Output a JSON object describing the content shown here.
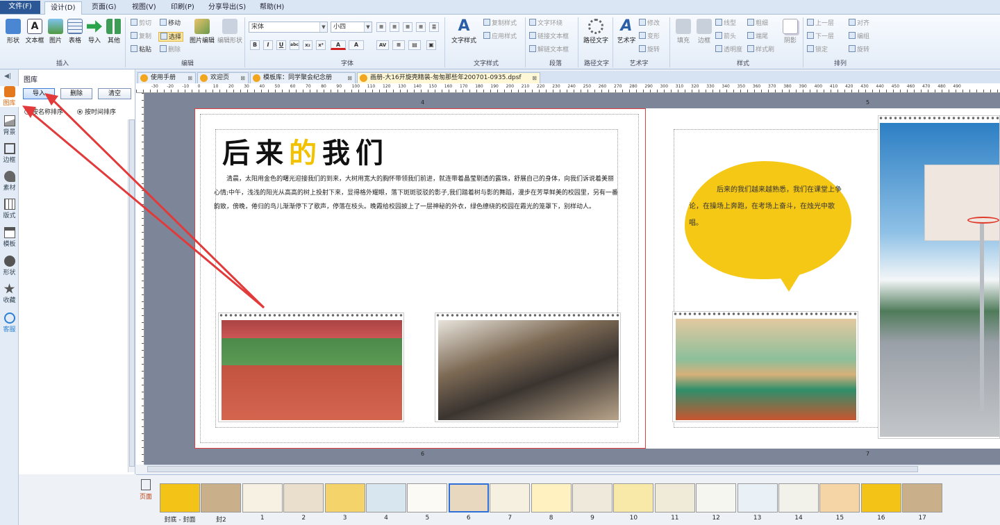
{
  "menu": [
    "文件(F)",
    "设计(D)",
    "页面(G)",
    "视图(V)",
    "印刷(P)",
    "分享导出(S)",
    "帮助(H)"
  ],
  "ribbon": {
    "insert": {
      "buttons": [
        "形状",
        "文本框",
        "图片",
        "表格",
        "导入",
        "其他"
      ],
      "label": "插入"
    },
    "edit": {
      "items": [
        "剪切",
        "复制",
        "粘贴",
        "移动",
        "选择",
        "删除"
      ],
      "big": "图片编辑",
      "big2": "编辑形状",
      "label": "编辑"
    },
    "font": {
      "face": "宋体",
      "size": "小四",
      "label": "字体"
    },
    "textstyle": {
      "big": "文字样式",
      "items": [
        "复制样式",
        "应用样式"
      ],
      "label": "文字样式"
    },
    "paragraph": {
      "items": [
        "文字环绕",
        "链接文本框",
        "解链文本框"
      ],
      "label": "段落"
    },
    "pathtext": {
      "big": "路径文字",
      "label": "路径文字"
    },
    "arttext": {
      "big": "艺术字",
      "items": [
        "修改",
        "变形",
        "旋转"
      ],
      "label": "艺术字"
    },
    "style": {
      "items": [
        "填充",
        "边框",
        "线型",
        "粗细",
        "箭头",
        "端尾",
        "透明度",
        "样式刷",
        "阴影"
      ],
      "label": "样式"
    },
    "arrange": {
      "items": [
        "上一层",
        "下一层",
        "锁定",
        "对齐",
        "编组",
        "旋转"
      ],
      "label": "排列"
    }
  },
  "leftstrip": [
    "图库",
    "背景",
    "边框",
    "素材",
    "版式",
    "模板",
    "形状",
    "收藏",
    "客服"
  ],
  "panel": {
    "title": "图库",
    "buttons": [
      "导入",
      "删除",
      "清空"
    ],
    "sort_name": "按名称排序",
    "sort_time": "按时间排序"
  },
  "tabs": [
    "使用手册",
    "欢迎页",
    "模板库：同学聚会纪念册",
    "画册-大16开旋壳精装-匆匆那些年200701-0935.dpsf"
  ],
  "ruler_ticks": [
    "-30",
    "-20",
    "-10",
    "0",
    "10",
    "20",
    "30",
    "40",
    "50",
    "60",
    "70",
    "80",
    "90",
    "100",
    "110",
    "120",
    "130",
    "140",
    "150",
    "160",
    "170",
    "180",
    "190",
    "200",
    "210",
    "220",
    "230",
    "240",
    "250",
    "260",
    "270",
    "280",
    "290",
    "300",
    "310",
    "320",
    "330",
    "340",
    "350",
    "360",
    "370",
    "380",
    "390",
    "400",
    "410",
    "420",
    "430",
    "440",
    "450",
    "460",
    "470",
    "480",
    "490"
  ],
  "page": {
    "left_num_top": "4",
    "right_num_top": "5",
    "left_num_bottom": "6",
    "right_num_bottom": "7",
    "title_a": "后来",
    "title_b": "的",
    "title_c": "我们",
    "body": "清晨，太阳用金色的曙光迎接我们的到来，大树用宽大的胸怀带领我们前进，就连带着晶莹剔透的露珠，舒展自己的身体，向我们诉说着美丽心情;中午，浅浅的阳光从高高的树上投射下来，显得格外耀眼，落下斑斑驳驳的影子,我们踏着树与影的舞蹈，漫步在芳草鲜美的校园里，另有一番韵致，傍晚，倦归的鸟儿渐渐停下了歌声，停落在枝头。晚霞给校园披上了一层神秘的外衣，绿色缭绕的校园在霞光的笼罩下，别样动人。",
    "bubble": "后来的我们越来越熟悉，我们在课堂上争论，在操场上奔跑，在考场上奋斗，在烛光中歌唱。"
  },
  "thumbs": [
    "封底 - 封面",
    "封2",
    "1",
    "2",
    "3",
    "4",
    "5",
    "6",
    "7",
    "8",
    "9",
    "10",
    "11",
    "12",
    "13",
    "14",
    "15",
    "16",
    "17"
  ],
  "side_tabs": [
    "页面"
  ]
}
